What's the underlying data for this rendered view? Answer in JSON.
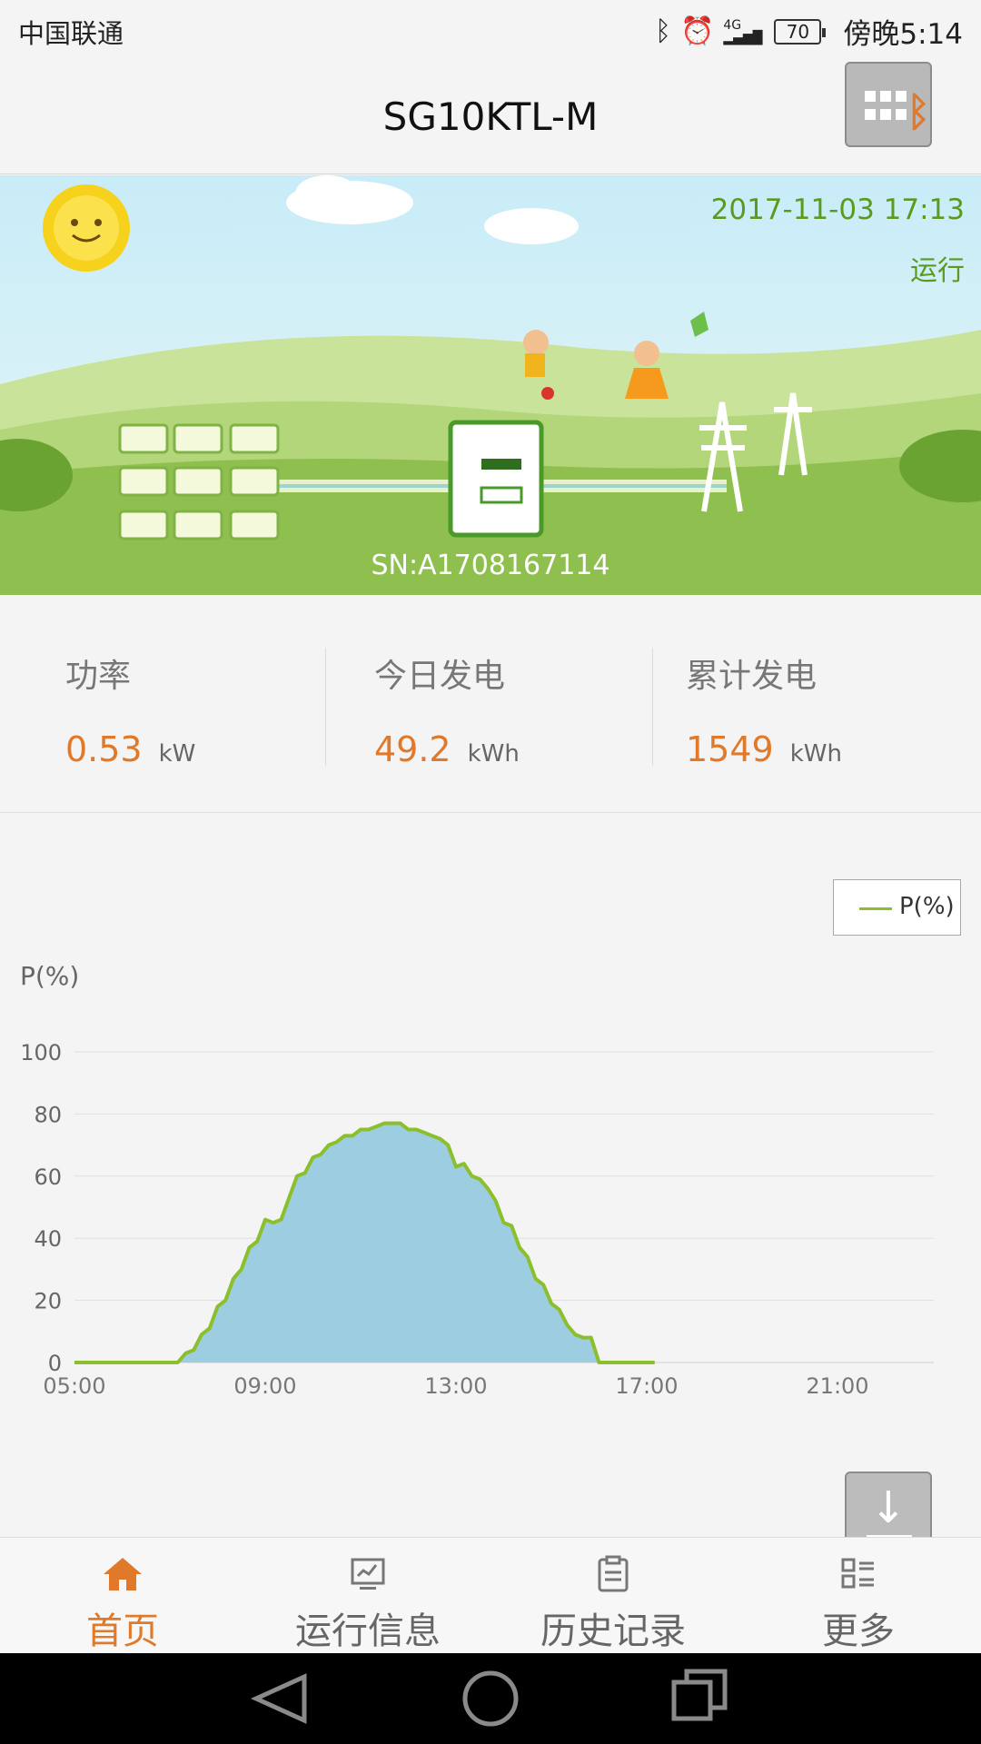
{
  "status_bar": {
    "carrier": "中国联通",
    "network": "4G",
    "battery": "70",
    "time": "傍晚5:14"
  },
  "header": {
    "title": "SG10KTL-M",
    "menu_icon": "grid-menu-icon",
    "bluetooth_icon": "bluetooth-icon"
  },
  "banner": {
    "datetime": "2017-11-03 17:13",
    "status": "运行",
    "sn": "SN:A1708167114"
  },
  "stats": [
    {
      "label": "功率",
      "value": "0.53",
      "unit": "kW"
    },
    {
      "label": "今日发电",
      "value": "49.2",
      "unit": "kWh"
    },
    {
      "label": "累计发电",
      "value": "1549",
      "unit": "kWh"
    }
  ],
  "chart_data": {
    "type": "area",
    "ylabel": "P(%)",
    "legend": [
      "P(%)"
    ],
    "legend_position": "top-right",
    "ylim": [
      0,
      100
    ],
    "yticks": [
      "0",
      "20",
      "40",
      "60",
      "80",
      "100"
    ],
    "xticks": [
      "05:00",
      "09:00",
      "13:00",
      "17:00",
      "21:00"
    ],
    "xlim_hours": [
      5,
      22
    ],
    "grid": true,
    "colors": {
      "line": "#8cbf2c",
      "fill": "#9ccde0"
    },
    "series": [
      {
        "name": "P(%)",
        "x": [
          "05:00",
          "06:00",
          "07:00",
          "07:10",
          "07:20",
          "07:30",
          "07:40",
          "07:50",
          "08:00",
          "08:10",
          "08:20",
          "08:30",
          "08:40",
          "08:50",
          "09:00",
          "09:10",
          "09:20",
          "09:30",
          "09:40",
          "09:50",
          "10:00",
          "10:10",
          "10:20",
          "10:30",
          "10:40",
          "10:50",
          "11:00",
          "11:10",
          "11:20",
          "11:30",
          "11:40",
          "11:50",
          "12:00",
          "12:10",
          "12:20",
          "12:30",
          "12:40",
          "12:50",
          "13:00",
          "13:10",
          "13:20",
          "13:30",
          "13:40",
          "13:50",
          "14:00",
          "14:10",
          "14:20",
          "14:30",
          "14:40",
          "14:50",
          "15:00",
          "15:10",
          "15:20",
          "15:30",
          "15:40",
          "15:50",
          "16:00",
          "16:10",
          "16:20",
          "16:30",
          "16:40",
          "16:50",
          "17:00",
          "17:10"
        ],
        "values": [
          0,
          0,
          0,
          0,
          3,
          4,
          9,
          11,
          18,
          20,
          27,
          30,
          37,
          39,
          46,
          45,
          46,
          53,
          60,
          61,
          66,
          67,
          70,
          71,
          73,
          73,
          75,
          75,
          76,
          77,
          77,
          77,
          75,
          75,
          74,
          73,
          72,
          70,
          63,
          64,
          60,
          59,
          56,
          52,
          45,
          44,
          37,
          34,
          27,
          25,
          19,
          17,
          12,
          9,
          8,
          8,
          0,
          0,
          0,
          0,
          0,
          0,
          0,
          0
        ]
      }
    ]
  },
  "tabs": [
    {
      "label": "首页",
      "icon": "home-icon",
      "active": true
    },
    {
      "label": "运行信息",
      "icon": "monitor-icon",
      "active": false
    },
    {
      "label": "历史记录",
      "icon": "clipboard-icon",
      "active": false
    },
    {
      "label": "更多",
      "icon": "more-grid-icon",
      "active": false
    }
  ],
  "download_icon": "download-icon",
  "nav": {
    "back": "back-icon",
    "home": "home-circle-icon",
    "recents": "recents-icon"
  }
}
